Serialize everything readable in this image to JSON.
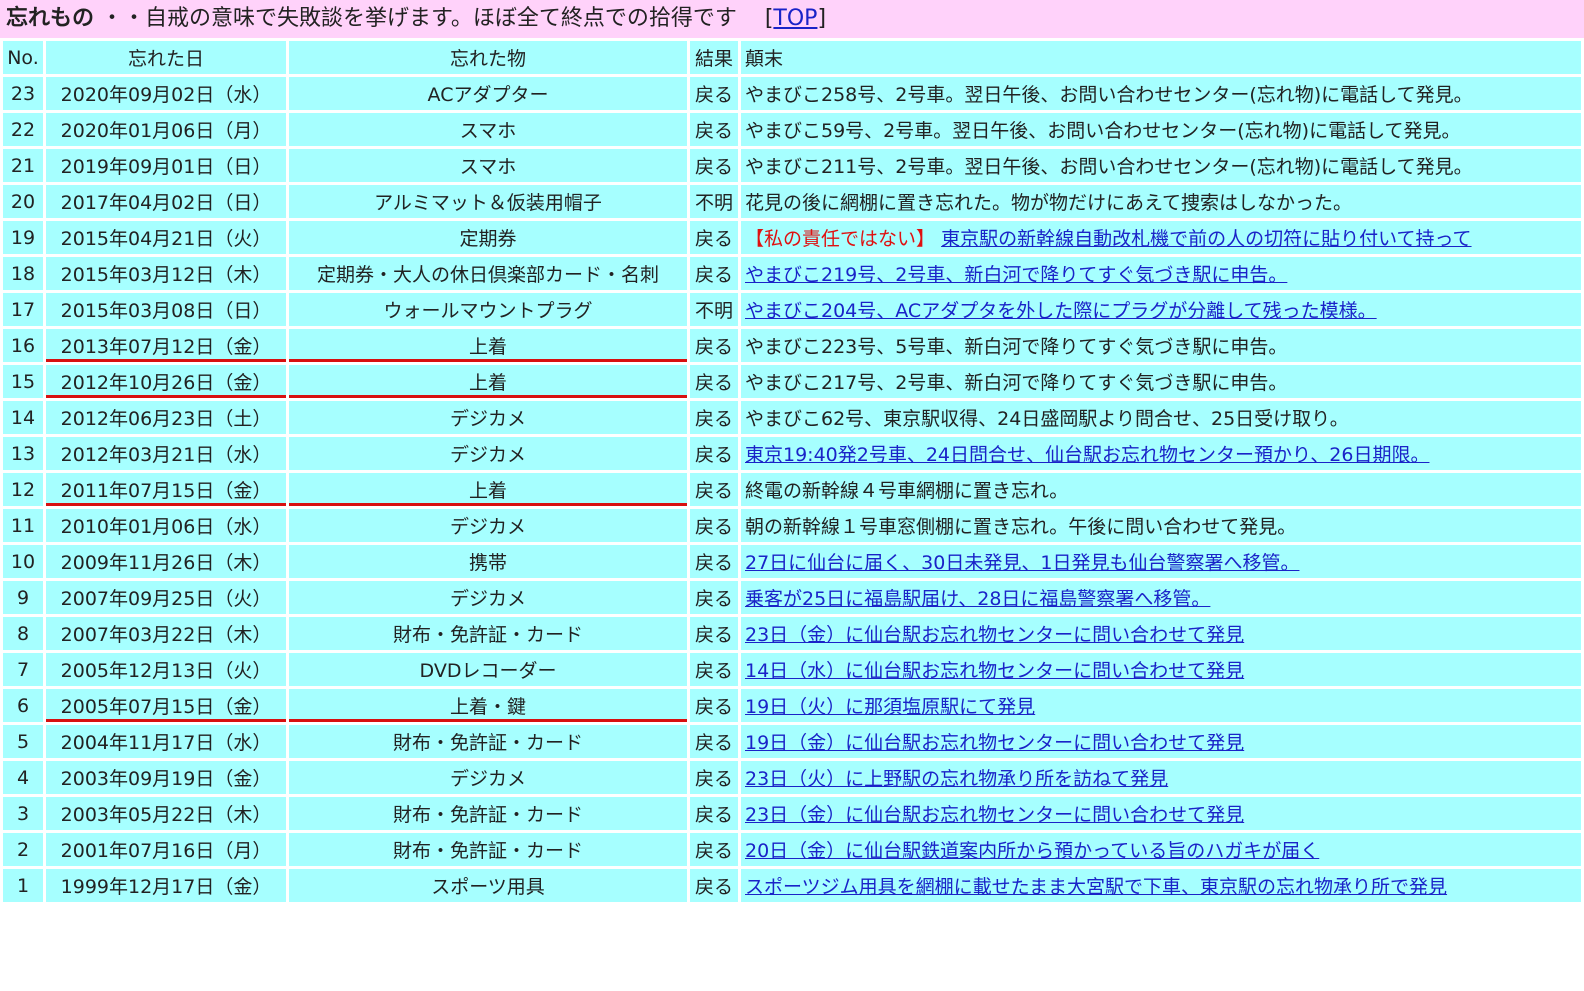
{
  "header": {
    "title": "忘れもの",
    "subtitle": "・・自戒の意味で失敗談を挙げます。ほぼ全て終点での拾得です",
    "link_open": "[",
    "link_label": "TOP",
    "link_close": "]"
  },
  "table": {
    "columns": [
      "No.",
      "忘れた日",
      "忘れた物",
      "結果",
      "顛末"
    ],
    "rows": [
      {
        "no": "23",
        "date": "2020年09月02日（水）",
        "item": "ACアダプター",
        "result": "戻る",
        "note": "やまびこ258号、2号車。翌日午後、お問い合わせセンター(忘れ物)に電話して発見。",
        "link": false
      },
      {
        "no": "22",
        "date": "2020年01月06日（月）",
        "item": "スマホ",
        "result": "戻る",
        "note": "やまびこ59号、2号車。翌日午後、お問い合わせセンター(忘れ物)に電話して発見。",
        "link": false
      },
      {
        "no": "21",
        "date": "2019年09月01日（日）",
        "item": "スマホ",
        "result": "戻る",
        "note": "やまびこ211号、2号車。翌日午後、お問い合わせセンター(忘れ物)に電話して発見。",
        "link": false
      },
      {
        "no": "20",
        "date": "2017年04月02日（日）",
        "item": "アルミマット＆仮装用帽子",
        "result": "不明",
        "note": "花見の後に網棚に置き忘れた。物が物だけにあえて捜索はしなかった。",
        "link": false
      },
      {
        "no": "19",
        "date": "2015年04月21日（火）",
        "item": "定期券",
        "result": "戻る",
        "note_warn": "【私の責任ではない】",
        "note": "東京駅の新幹線自動改札機で前の人の切符に貼り付いて持って",
        "link": true
      },
      {
        "no": "18",
        "date": "2015年03月12日（木）",
        "item": "定期券・大人の休日倶楽部カード・名刺",
        "result": "戻る",
        "note": "やまびこ219号、2号車、新白河で降りてすぐ気づき駅に申告。",
        "link": true
      },
      {
        "no": "17",
        "date": "2015年03月08日（日）",
        "item": "ウォールマウントプラグ",
        "result": "不明",
        "note": "やまびこ204号、ACアダプタを外した際にプラグが分離して残った模様。",
        "link": true
      },
      {
        "no": "16",
        "date": "2013年07月12日（金）",
        "item": "上着",
        "result": "戻る",
        "note": "やまびこ223号、5号車、新白河で降りてすぐ気づき駅に申告。",
        "link": false
      },
      {
        "no": "15",
        "date": "2012年10月26日（金）",
        "item": "上着",
        "result": "戻る",
        "note": "やまびこ217号、2号車、新白河で降りてすぐ気づき駅に申告。",
        "link": false
      },
      {
        "no": "14",
        "date": "2012年06月23日（土）",
        "item": "デジカメ",
        "result": "戻る",
        "note": "やまびこ62号、東京駅収得、24日盛岡駅より問合せ、25日受け取り。",
        "link": false
      },
      {
        "no": "13",
        "date": "2012年03月21日（水）",
        "item": "デジカメ",
        "result": "戻る",
        "note": "東京19:40発2号車、24日問合せ、仙台駅お忘れ物センター預かり、26日期限。",
        "link": true
      },
      {
        "no": "12",
        "date": "2011年07月15日（金）",
        "item": "上着",
        "result": "戻る",
        "note": "終電の新幹線４号車網棚に置き忘れ。",
        "link": false
      },
      {
        "no": "11",
        "date": "2010年01月06日（水）",
        "item": "デジカメ",
        "result": "戻る",
        "note": "朝の新幹線１号車窓側棚に置き忘れ。午後に問い合わせて発見。",
        "link": false
      },
      {
        "no": "10",
        "date": "2009年11月26日（木）",
        "item": "携帯",
        "result": "戻る",
        "note": "27日に仙台に届く、30日未発見、1日発見も仙台警察署へ移管。",
        "link": true
      },
      {
        "no": "9",
        "date": "2007年09月25日（火）",
        "item": "デジカメ",
        "result": "戻る",
        "note": "乗客が25日に福島駅届け、28日に福島警察署へ移管。",
        "link": true
      },
      {
        "no": "8",
        "date": "2007年03月22日（木）",
        "item": "財布・免許証・カード",
        "result": "戻る",
        "note": "23日（金）に仙台駅お忘れ物センターに問い合わせて発見",
        "link": true
      },
      {
        "no": "7",
        "date": "2005年12月13日（火）",
        "item": "DVDレコーダー",
        "result": "戻る",
        "note": "14日（水）に仙台駅お忘れ物センターに問い合わせて発見",
        "link": true
      },
      {
        "no": "6",
        "date": "2005年07月15日（金）",
        "item": "上着・鍵",
        "result": "戻る",
        "note": "19日（火）に那須塩原駅にて発見",
        "link": true
      },
      {
        "no": "5",
        "date": "2004年11月17日（水）",
        "item": "財布・免許証・カード",
        "result": "戻る",
        "note": "19日（金）に仙台駅お忘れ物センターに問い合わせて発見",
        "link": true
      },
      {
        "no": "4",
        "date": "2003年09月19日（金）",
        "item": "デジカメ",
        "result": "戻る",
        "note": "23日（火）に上野駅の忘れ物承り所を訪ねて発見",
        "link": true
      },
      {
        "no": "3",
        "date": "2003年05月22日（木）",
        "item": "財布・免許証・カード",
        "result": "戻る",
        "note": "23日（金）に仙台駅お忘れ物センターに問い合わせて発見",
        "link": true
      },
      {
        "no": "2",
        "date": "2001年07月16日（月）",
        "item": "財布・免許証・カード",
        "result": "戻る",
        "note": "20日（金）に仙台駅鉄道案内所から預かっている旨のハガキが届く",
        "link": true
      },
      {
        "no": "1",
        "date": "1999年12月17日（金）",
        "item": "スポーツ用具",
        "result": "戻る",
        "note": "スポーツジム用具を網棚に載せたまま大宮駅で下車、東京駅の忘れ物承り所で発見",
        "link": true
      }
    ]
  },
  "colors": {
    "header_bg": "#ffd2fa",
    "cell_bg": "#a6ffff",
    "link": "#1a23c8",
    "warn": "#e01010",
    "underline_red": "#d81010"
  }
}
